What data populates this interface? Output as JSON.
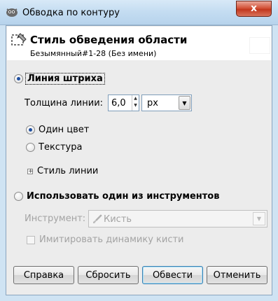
{
  "window": {
    "title": "Обводка по контуру",
    "close_label": "x"
  },
  "header": {
    "title": "Стиль обведения области",
    "subtitle": "Безымянный#1-28 (Без имени)"
  },
  "stroke_line": {
    "label": "Линия штриха",
    "selected": true,
    "width_label": "Толщина линии:",
    "width_value": "6,0",
    "unit_value": "px",
    "fill_options": [
      {
        "label": "Один цвет",
        "selected": true
      },
      {
        "label": "Текстура",
        "selected": false
      }
    ],
    "line_style_label": "Стиль линии"
  },
  "use_tool": {
    "label": "Использовать один из инструментов",
    "selected": false,
    "tool_label": "Инструмент:",
    "tool_value": "Кисть",
    "emulate_label": "Имитировать динамику кисти",
    "emulate_checked": false
  },
  "buttons": {
    "help": "Справка",
    "reset": "Сбросить",
    "stroke": "Обвести",
    "cancel": "Отменить"
  }
}
